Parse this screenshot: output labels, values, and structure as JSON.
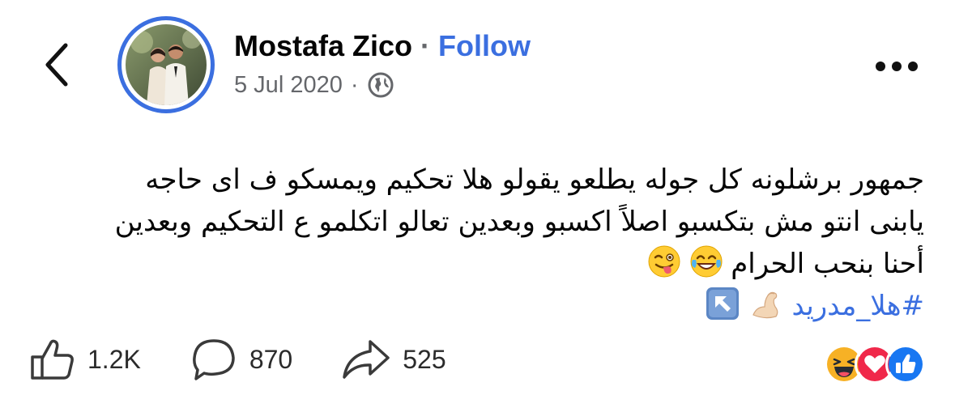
{
  "header": {
    "author_name": "Mostafa Zico",
    "separator": "·",
    "follow_label": "Follow",
    "date": "5 Jul 2020",
    "meta_separator": "·"
  },
  "post": {
    "lines": [
      "جمهور برشلونه كل جوله يطلعو يقولو هلا تحكيم ويمسكو ف اى حاجه",
      "يابنى انتو مش بتكسبو اصلاً اكسبو وبعدين تعالو اتكلمو ع التحكيم وبعدين",
      "أحنا بنحب الحرام"
    ],
    "hashtag": "#هلا_مدريد"
  },
  "actions": {
    "likes": "1.2K",
    "comments": "870",
    "shares": "525"
  },
  "icons": {
    "back": "chevron-left-icon",
    "privacy": "globe-icon",
    "more": "more-horizontal-icon",
    "like": "thumbs-up-icon",
    "comment": "comment-bubble-icon",
    "share": "share-arrow-icon"
  },
  "colors": {
    "accent": "#3b6fe0",
    "secondary_text": "#65676b",
    "like_reaction": "#1877f2",
    "love_reaction": "#f0284a",
    "haha_reaction": "#f7b125"
  }
}
